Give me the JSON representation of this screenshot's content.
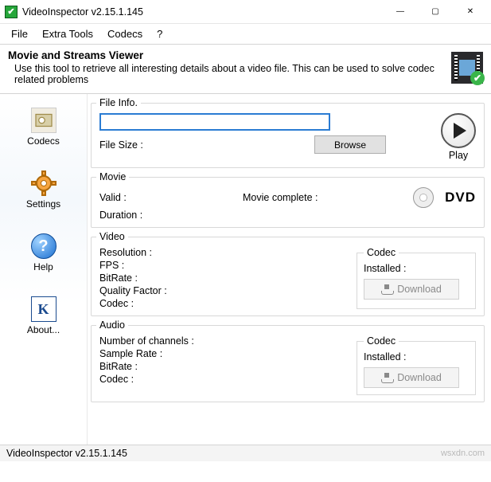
{
  "window": {
    "title": "VideoInspector v2.15.1.145",
    "minimize_glyph": "—",
    "maximize_glyph": "▢",
    "close_glyph": "✕"
  },
  "menu": {
    "file": "File",
    "extra": "Extra Tools",
    "codecs": "Codecs",
    "help": "?"
  },
  "header": {
    "title": "Movie and Streams Viewer",
    "desc": "Use this tool to retrieve all interesting details about a video file. This can be used to solve codec related problems"
  },
  "nav": {
    "codecs": "Codecs",
    "settings": "Settings",
    "help": "Help",
    "about": "About..."
  },
  "file_panel": {
    "legend": "File Info.",
    "value": "",
    "file_size_label": "File Size :",
    "browse": "Browse",
    "play": "Play"
  },
  "movie_panel": {
    "legend": "Movie",
    "valid": "Valid :",
    "complete": "Movie complete :",
    "duration": "Duration :",
    "dvd": "DVD"
  },
  "video_panel": {
    "legend": "Video",
    "resolution": "Resolution :",
    "fps": "FPS :",
    "bitrate": "BitRate :",
    "quality": "Quality Factor :",
    "codec": "Codec :",
    "codec_box": "Codec",
    "installed": "Installed :",
    "download": "Download"
  },
  "audio_panel": {
    "legend": "Audio",
    "channels": "Number of channels :",
    "sample": "Sample Rate :",
    "bitrate": "BitRate :",
    "codec": "Codec :",
    "codec_box": "Codec",
    "installed": "Installed :",
    "download": "Download"
  },
  "status": {
    "text": "VideoInspector v2.15.1.145",
    "watermark": "wsxdn.com"
  }
}
